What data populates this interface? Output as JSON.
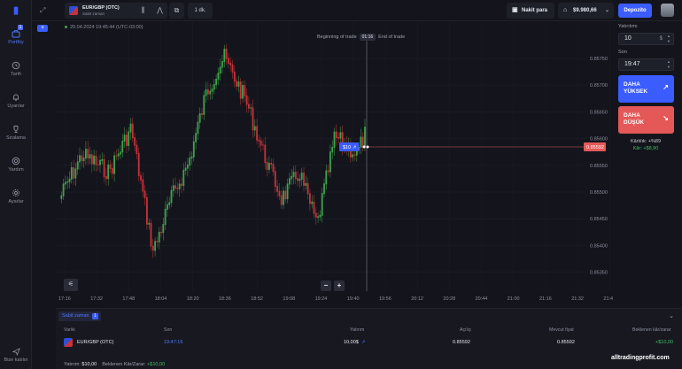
{
  "sidebar": {
    "items": [
      {
        "label": "Portföy",
        "icon": "briefcase-icon",
        "badge": "1",
        "active": true
      },
      {
        "label": "Tarih",
        "icon": "clock-icon"
      },
      {
        "label": "Uyarılar",
        "icon": "bell-icon"
      },
      {
        "label": "Sıralama",
        "icon": "trophy-icon"
      },
      {
        "label": "Yardım",
        "icon": "help-icon"
      },
      {
        "label": "Ayarlar",
        "icon": "gear-icon"
      }
    ],
    "add_label": "+",
    "logout_label": "Bize katılın"
  },
  "topbar": {
    "asset_name": "EUR/GBP (OTC)",
    "asset_sub": "Sabit zaman",
    "timeframe": "1 dk.",
    "cash_label": "Nakit para",
    "balance": "$9.980,66",
    "deposit_label": "Depozito"
  },
  "chart": {
    "datetime": "20.04.2024 19:45:44 (UTC-03:00)",
    "begin_label": "Beginning of trade",
    "timer": "01:16",
    "end_label": "End of trade",
    "trade_marker": "$10",
    "current_price": "0.85592",
    "y_ticks": [
      "0.85750",
      "0.85700",
      "0.85650",
      "0.85600",
      "0.85550",
      "0.85500",
      "0.85450",
      "0.85400",
      "0.85350"
    ],
    "x_ticks": [
      "17:16",
      "17:32",
      "17:48",
      "18:04",
      "18:20",
      "18:36",
      "18:52",
      "19:08",
      "19:24",
      "19:40",
      "19:56",
      "20:12",
      "20:28",
      "20:44",
      "21:00",
      "21:16",
      "21:32",
      "21:4"
    ],
    "colors": {
      "up": "#3fa34d",
      "down": "#c8323a",
      "marker": "#3b5cff",
      "price": "#e45858"
    }
  },
  "panel": {
    "amount_label": "Yatırılımı",
    "amount_value": "10",
    "amount_unit": "$",
    "time_label": "Son",
    "time_value": "19:47",
    "up_label_1": "DAHA",
    "up_label_2": "YÜKSEK",
    "down_label_1": "DAHA",
    "down_label_2": "DÜŞÜK",
    "profitability": "Kârlılık: +%89",
    "profit": "Kâr: +$8,90"
  },
  "bottom": {
    "tab_label": "Sabit zaman",
    "tab_count": "1",
    "columns": [
      "Varlık",
      "Son",
      "Yatırım",
      "Açılış",
      "Mevcut fiyat",
      "Beklenen kâr/zarar"
    ],
    "rows": [
      {
        "asset": "EUR/GBP (OTC)",
        "end": "19:47:16",
        "amount": "10,00$",
        "open": "0.85592",
        "current": "0.85592",
        "expected": "+$10,00"
      }
    ],
    "summary_invest_label": "Yatırım:",
    "summary_invest": "$10,00",
    "summary_expected_label": "Beklenen Kâr/Zarar:",
    "summary_expected": "+$10,00"
  },
  "watermark": "alltradingprofit.com"
}
